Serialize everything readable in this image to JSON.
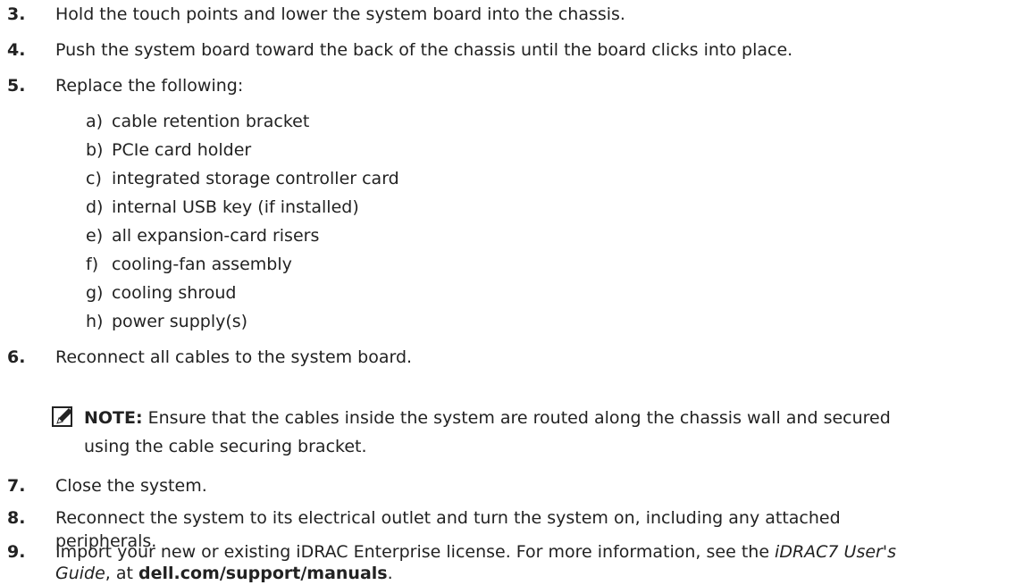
{
  "steps": [
    {
      "num": "3.",
      "text": "Hold the touch points and lower the system board into the chassis."
    },
    {
      "num": "4.",
      "text": "Push the system board toward the back of the chassis until the board clicks into place."
    },
    {
      "num": "5.",
      "text": "Replace the following:"
    },
    {
      "num": "6.",
      "text": "Reconnect all cables to the system board."
    },
    {
      "num": "7.",
      "text": "Close the system."
    },
    {
      "num": "8.",
      "text_line1": "Reconnect the system to its electrical outlet and turn the system on, including any attached",
      "text_line2": "peripherals."
    },
    {
      "num": "9.",
      "text_line1": "Import your new or existing iDRAC Enterprise license. For more information, see the ",
      "link_italic": "iDRAC7 User's",
      "line2_italic": "Guide",
      "line2_mid": ", at ",
      "line2_bold": "dell.com/support/manuals",
      "line2_end": "."
    }
  ],
  "substeps": [
    {
      "letter": "a)",
      "text": "cable retention bracket"
    },
    {
      "letter": "b)",
      "text": "PCIe card holder"
    },
    {
      "letter": "c)",
      "text": "integrated storage controller card"
    },
    {
      "letter": "d)",
      "text": "internal USB key (if installed)"
    },
    {
      "letter": "e)",
      "text": "all expansion-card risers"
    },
    {
      "letter": "f)",
      "text": "cooling-fan assembly"
    },
    {
      "letter": "g)",
      "text": "cooling shroud"
    },
    {
      "letter": "h)",
      "text": "power supply(s)"
    }
  ],
  "note": {
    "label": "NOTE:",
    "line1": " Ensure that the cables inside the system are routed along the chassis wall and secured",
    "line2": "using the cable securing bracket.",
    "icon": "note-pencil-icon"
  }
}
